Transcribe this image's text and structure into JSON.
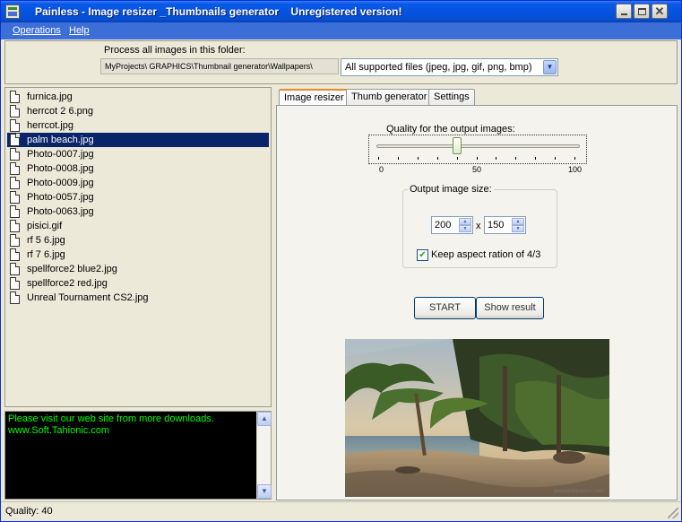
{
  "window": {
    "title": "Painless - Image resizer _Thumbnails generator    Unregistered version!",
    "app_icon": "app-icon",
    "buttons": {
      "minimize": "minimize-icon",
      "maximize": "maximize-icon",
      "close": "close-icon",
      "close_glyph": "✕"
    }
  },
  "menu": {
    "operations": "Operations",
    "help": "Help"
  },
  "folder": {
    "label": "Process all images in this folder:",
    "path": "MyProjects\\ GRAPHICS\\Thumbnail generator\\Wallpapers\\",
    "filter": "All supported files (jpeg, jpg, gif, png, bmp)"
  },
  "files": [
    "furnica.jpg",
    "herrcot 2 6.png",
    "herrcot.jpg",
    "palm beach.jpg",
    "Photo-0007.jpg",
    "Photo-0008.jpg",
    "Photo-0009.jpg",
    "Photo-0057.jpg",
    "Photo-0063.jpg",
    "pisici.gif",
    "rf 5 6.jpg",
    "rf 7 6.jpg",
    "spellforce2 blue2.jpg",
    "spellforce2 red.jpg",
    "Unreal Tournament CS2.jpg"
  ],
  "selected_file": "palm beach.jpg",
  "console": {
    "lines": "Please visit our web site from more downloads.\nwww.Soft.Tahionic.com"
  },
  "tabs": [
    "Image resizer",
    "Thumb generator",
    "Settings"
  ],
  "active_tab": "Image resizer",
  "quality": {
    "label": "Quality for the output images:",
    "value": 40,
    "min_label": "0",
    "mid_label": "50",
    "max_label": "100"
  },
  "size": {
    "label": "Output image size:",
    "width": "200",
    "height": "150",
    "separator": "x",
    "keep_aspect": true,
    "keep_aspect_label": "Keep aspect ration of 4/3"
  },
  "buttons": {
    "start": "START",
    "show_result": "Show result"
  },
  "preview": {
    "credit": "www.wallpapers.com"
  },
  "status": {
    "text": "Quality: 40"
  }
}
